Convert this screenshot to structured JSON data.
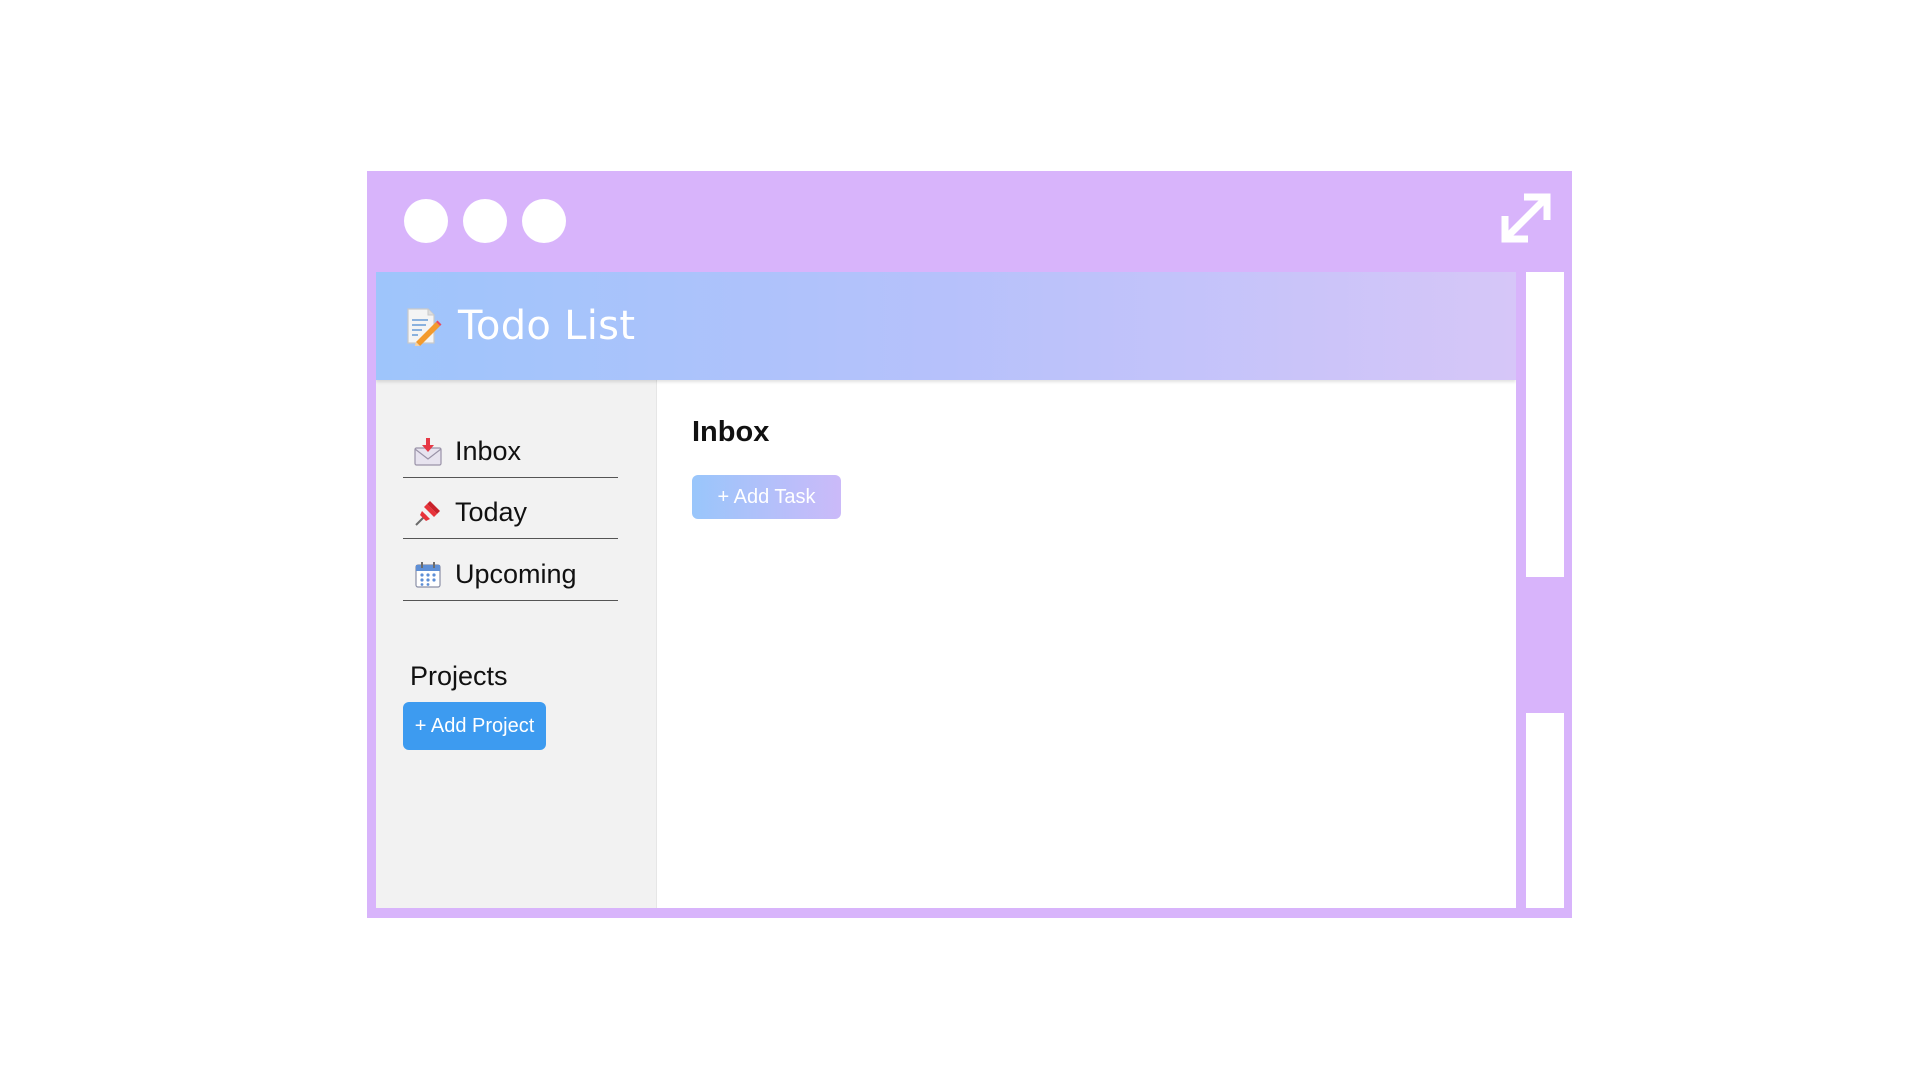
{
  "app": {
    "title": "Todo List",
    "logo_icon": "memo-pencil-icon"
  },
  "window_controls": {
    "expand_icon": "expand-arrows-icon"
  },
  "sidebar": {
    "items": [
      {
        "label": "Inbox",
        "icon": "inbox-tray-icon"
      },
      {
        "label": "Today",
        "icon": "pushpin-icon"
      },
      {
        "label": "Upcoming",
        "icon": "calendar-icon"
      }
    ],
    "projects_title": "Projects",
    "add_project_label": "+ Add Project"
  },
  "main": {
    "title": "Inbox",
    "add_task_label": "+ Add Task"
  },
  "colors": {
    "frame": "#d8b4fb",
    "header_gradient_start": "#9ec5fb",
    "header_gradient_end": "#d6c6f8",
    "primary_button": "#3d9bf0",
    "sidebar_bg": "#f2f2f2"
  }
}
